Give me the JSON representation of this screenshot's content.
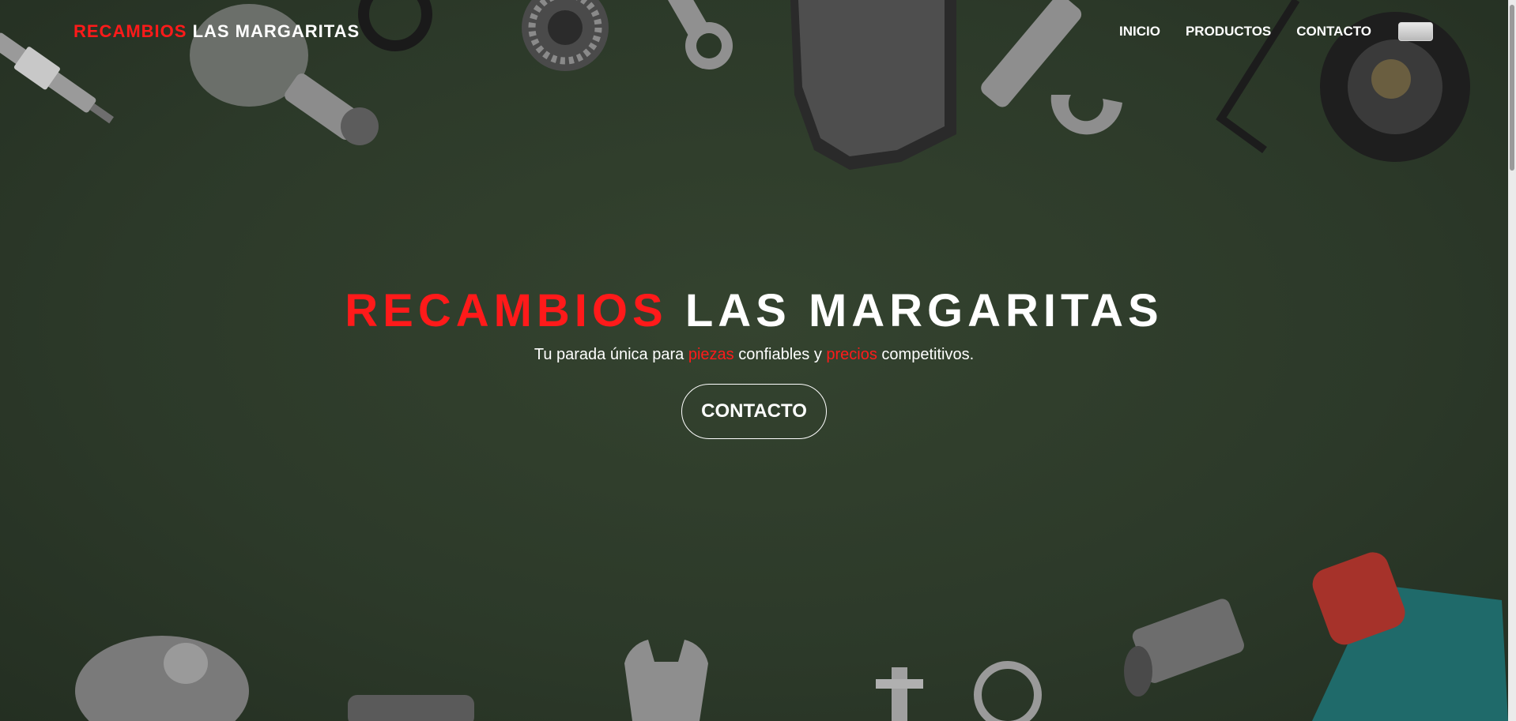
{
  "brand": {
    "accent": "RECAMBIOS",
    "rest": " LAS MARGARITAS"
  },
  "nav": {
    "items": [
      {
        "label": "INICIO"
      },
      {
        "label": "PRODUCTOS"
      },
      {
        "label": "CONTACTO"
      }
    ],
    "language_toggle_icon": "flag-icon"
  },
  "hero": {
    "title_accent": "RECAMBIOS",
    "title_rest": " LAS MARGARITAS",
    "subtitle": {
      "part1": "Tu parada única para ",
      "accent1": "piezas",
      "part2": " confiables y ",
      "accent2": "precios",
      "part3": " competitivos."
    },
    "button_label": "CONTACTO"
  },
  "colors": {
    "accent": "#ff1a1a",
    "text": "#ffffff",
    "background": "#2e3a2c"
  }
}
